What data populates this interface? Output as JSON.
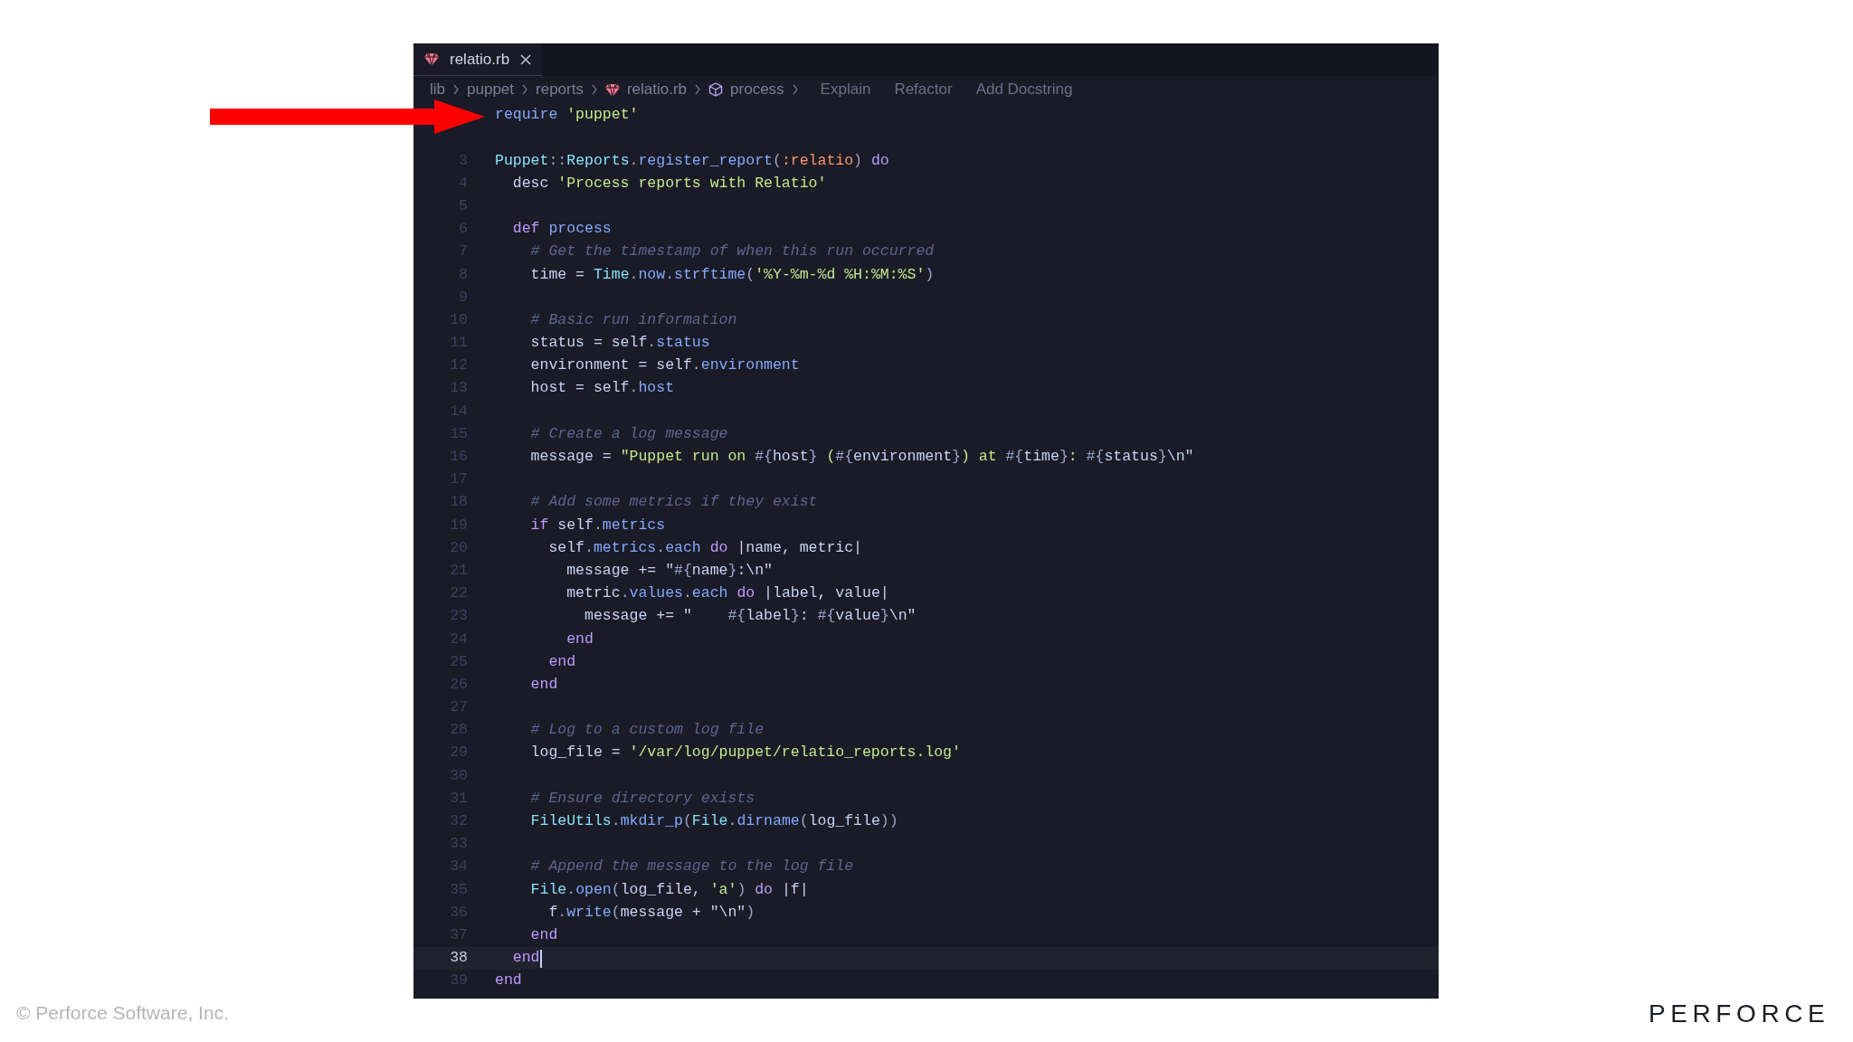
{
  "tab": {
    "label": "relatio.rb",
    "selected": true
  },
  "breadcrumb": [
    {
      "label": "lib",
      "kind": "folder"
    },
    {
      "label": "puppet",
      "kind": "folder"
    },
    {
      "label": "reports",
      "kind": "folder"
    },
    {
      "label": "relatio.rb",
      "kind": "file"
    },
    {
      "label": "process",
      "kind": "method"
    }
  ],
  "code_actions": [
    "Explain",
    "Refactor",
    "Add Docstring"
  ],
  "lines": [
    {
      "current": false,
      "tokens": [
        {
          "text": "require ",
          "kind": "method"
        },
        {
          "text": "'puppet'",
          "kind": "string"
        }
      ]
    },
    {
      "current": false
    },
    {
      "number": "3",
      "current": false,
      "tokens": [
        {
          "text": "Puppet",
          "kind": "constant"
        },
        {
          "text": "::",
          "kind": "brace"
        },
        {
          "text": "Reports",
          "kind": "constant"
        },
        {
          "text": ".",
          "kind": "brace"
        },
        {
          "text": "register_report",
          "kind": "method"
        },
        {
          "text": "(",
          "kind": "brace"
        },
        {
          "text": ":relatio",
          "kind": "symbol"
        },
        {
          "text": ") ",
          "kind": "brace"
        },
        {
          "text": "do",
          "kind": "keyword"
        }
      ]
    },
    {
      "number": "4",
      "current": false,
      "tokens": [
        {
          "text": "  desc ",
          "kind": "plain"
        },
        {
          "text": "'Process reports with Relatio'",
          "kind": "string"
        }
      ]
    },
    {
      "number": "5",
      "current": false
    },
    {
      "number": "6",
      "current": false,
      "tokens": [
        {
          "text": "  def ",
          "kind": "keyword"
        },
        {
          "text": "process",
          "kind": "method"
        }
      ]
    },
    {
      "number": "7",
      "current": false,
      "tokens": [
        {
          "text": "    # Get the timestamp of when this run occurred",
          "kind": "comment"
        }
      ]
    },
    {
      "number": "8",
      "current": false,
      "tokens": [
        {
          "text": "    time = ",
          "kind": "plain"
        },
        {
          "text": "Time",
          "kind": "constant"
        },
        {
          "text": ".",
          "kind": "brace"
        },
        {
          "text": "now",
          "kind": "method"
        },
        {
          "text": ".",
          "kind": "brace"
        },
        {
          "text": "strftime",
          "kind": "method"
        },
        {
          "text": "(",
          "kind": "brace"
        },
        {
          "text": "'%Y-%m-%d %H:%M:%S'",
          "kind": "string"
        },
        {
          "text": ")",
          "kind": "brace"
        }
      ]
    },
    {
      "number": "9",
      "current": false
    },
    {
      "number": "10",
      "current": false,
      "tokens": [
        {
          "text": "    # Basic run information",
          "kind": "comment"
        }
      ]
    },
    {
      "number": "11",
      "current": false,
      "tokens": [
        {
          "text": "    status = self",
          "kind": "plain"
        },
        {
          "text": ".",
          "kind": "brace"
        },
        {
          "text": "status",
          "kind": "method"
        }
      ]
    },
    {
      "number": "12",
      "current": false,
      "tokens": [
        {
          "text": "    environment = self",
          "kind": "plain"
        },
        {
          "text": ".",
          "kind": "brace"
        },
        {
          "text": "environment",
          "kind": "method"
        }
      ]
    },
    {
      "number": "13",
      "current": false,
      "tokens": [
        {
          "text": "    host = self",
          "kind": "plain"
        },
        {
          "text": ".",
          "kind": "brace"
        },
        {
          "text": "host",
          "kind": "method"
        }
      ]
    },
    {
      "number": "14",
      "current": false
    },
    {
      "number": "15",
      "current": false,
      "tokens": [
        {
          "text": "    # Create a log message",
          "kind": "comment"
        }
      ]
    },
    {
      "number": "16",
      "current": false,
      "tokens": [
        {
          "text": "    message = ",
          "kind": "plain"
        },
        {
          "text": "\"Puppet run on ",
          "kind": "string"
        },
        {
          "text": "#{",
          "kind": "brace"
        },
        {
          "text": "host",
          "kind": "plain"
        },
        {
          "text": "}",
          "kind": "brace"
        },
        {
          "text": " (",
          "kind": "string"
        },
        {
          "text": "#{",
          "kind": "brace"
        },
        {
          "text": "environment",
          "kind": "plain"
        },
        {
          "text": "}",
          "kind": "brace"
        },
        {
          "text": ") at ",
          "kind": "string"
        },
        {
          "text": "#{",
          "kind": "brace"
        },
        {
          "text": "time",
          "kind": "plain"
        },
        {
          "text": "}",
          "kind": "brace"
        },
        {
          "text": ": ",
          "kind": "string"
        },
        {
          "text": "#{",
          "kind": "brace"
        },
        {
          "text": "status",
          "kind": "plain"
        },
        {
          "text": "}",
          "kind": "brace"
        },
        {
          "text": "\\n\"",
          "kind": "plain"
        }
      ]
    },
    {
      "number": "17",
      "current": false
    },
    {
      "number": "18",
      "current": false,
      "tokens": [
        {
          "text": "    # Add some metrics if they exist",
          "kind": "comment"
        }
      ]
    },
    {
      "number": "19",
      "current": false,
      "tokens": [
        {
          "text": "    if",
          "kind": "keyword"
        },
        {
          "text": " self",
          "kind": "plain"
        },
        {
          "text": ".",
          "kind": "brace"
        },
        {
          "text": "metrics",
          "kind": "method"
        }
      ]
    },
    {
      "number": "20",
      "current": false,
      "tokens": [
        {
          "text": "      self",
          "kind": "plain"
        },
        {
          "text": ".",
          "kind": "brace"
        },
        {
          "text": "metrics",
          "kind": "method"
        },
        {
          "text": ".",
          "kind": "brace"
        },
        {
          "text": "each ",
          "kind": "method"
        },
        {
          "text": "do",
          "kind": "keyword"
        },
        {
          "text": " |name, metric|",
          "kind": "plain"
        }
      ]
    },
    {
      "number": "21",
      "current": false,
      "tokens": [
        {
          "text": "        message += \"",
          "kind": "plain"
        },
        {
          "text": "#{",
          "kind": "brace"
        },
        {
          "text": "name",
          "kind": "plain"
        },
        {
          "text": "}",
          "kind": "brace"
        },
        {
          "text": ":\\n\"",
          "kind": "plain"
        }
      ]
    },
    {
      "number": "22",
      "current": false,
      "tokens": [
        {
          "text": "        metric",
          "kind": "plain"
        },
        {
          "text": ".",
          "kind": "brace"
        },
        {
          "text": "values",
          "kind": "method"
        },
        {
          "text": ".",
          "kind": "brace"
        },
        {
          "text": "each ",
          "kind": "method"
        },
        {
          "text": "do",
          "kind": "keyword"
        },
        {
          "text": " |label, value|",
          "kind": "plain"
        }
      ]
    },
    {
      "number": "23",
      "current": false,
      "tokens": [
        {
          "text": "          message += \"    ",
          "kind": "plain"
        },
        {
          "text": "#{",
          "kind": "brace"
        },
        {
          "text": "label",
          "kind": "plain"
        },
        {
          "text": "}",
          "kind": "brace"
        },
        {
          "text": ": ",
          "kind": "plain"
        },
        {
          "text": "#{",
          "kind": "brace"
        },
        {
          "text": "value",
          "kind": "plain"
        },
        {
          "text": "}",
          "kind": "brace"
        },
        {
          "text": "\\n\"",
          "kind": "plain"
        }
      ]
    },
    {
      "number": "24",
      "current": false,
      "tokens": [
        {
          "text": "        end",
          "kind": "keyword"
        }
      ]
    },
    {
      "number": "25",
      "current": false,
      "tokens": [
        {
          "text": "      end",
          "kind": "keyword"
        }
      ]
    },
    {
      "number": "26",
      "current": false,
      "tokens": [
        {
          "text": "    end",
          "kind": "keyword"
        }
      ]
    },
    {
      "number": "27",
      "current": false
    },
    {
      "number": "28",
      "current": false,
      "tokens": [
        {
          "text": "    # Log to a custom log file",
          "kind": "comment"
        }
      ]
    },
    {
      "number": "29",
      "current": false,
      "tokens": [
        {
          "text": "    log_file = ",
          "kind": "plain"
        },
        {
          "text": "'/var/log/puppet/relatio_reports.log'",
          "kind": "string"
        }
      ]
    },
    {
      "number": "30",
      "current": false
    },
    {
      "number": "31",
      "current": false,
      "tokens": [
        {
          "text": "    # Ensure directory exists",
          "kind": "comment"
        }
      ]
    },
    {
      "number": "32",
      "current": false,
      "tokens": [
        {
          "text": "    FileUtils",
          "kind": "constant"
        },
        {
          "text": ".",
          "kind": "brace"
        },
        {
          "text": "mkdir_p",
          "kind": "method"
        },
        {
          "text": "(",
          "kind": "brace"
        },
        {
          "text": "File",
          "kind": "constant"
        },
        {
          "text": ".",
          "kind": "brace"
        },
        {
          "text": "dirname",
          "kind": "method"
        },
        {
          "text": "(",
          "kind": "brace"
        },
        {
          "text": "log_file",
          "kind": "plain"
        },
        {
          "text": "))",
          "kind": "brace"
        }
      ]
    },
    {
      "number": "33",
      "current": false
    },
    {
      "number": "34",
      "current": false,
      "tokens": [
        {
          "text": "    # Append the message to the log file",
          "kind": "comment"
        }
      ]
    },
    {
      "number": "35",
      "current": false,
      "tokens": [
        {
          "text": "    File",
          "kind": "constant"
        },
        {
          "text": ".",
          "kind": "brace"
        },
        {
          "text": "open",
          "kind": "method"
        },
        {
          "text": "(",
          "kind": "brace"
        },
        {
          "text": "log_file, ",
          "kind": "plain"
        },
        {
          "text": "'a'",
          "kind": "string"
        },
        {
          "text": ") ",
          "kind": "brace"
        },
        {
          "text": "do",
          "kind": "keyword"
        },
        {
          "text": " |f|",
          "kind": "plain"
        }
      ]
    },
    {
      "number": "36",
      "current": false,
      "tokens": [
        {
          "text": "      f",
          "kind": "plain"
        },
        {
          "text": ".",
          "kind": "brace"
        },
        {
          "text": "write",
          "kind": "method"
        },
        {
          "text": "(",
          "kind": "brace"
        },
        {
          "text": "message + \"\\n\"",
          "kind": "plain"
        },
        {
          "text": ")",
          "kind": "brace"
        }
      ]
    },
    {
      "number": "37",
      "current": false,
      "tokens": [
        {
          "text": "    end",
          "kind": "keyword"
        }
      ]
    },
    {
      "number": "38",
      "current": true,
      "tokens": [
        {
          "text": "  end",
          "kind": "keyword"
        }
      ]
    },
    {
      "number": "39",
      "current": false,
      "tokens": [
        {
          "text": "end",
          "kind": "keyword"
        }
      ]
    }
  ],
  "footer": {
    "copyright": "© Perforce Software, Inc.",
    "logo": "PERFORCE"
  }
}
